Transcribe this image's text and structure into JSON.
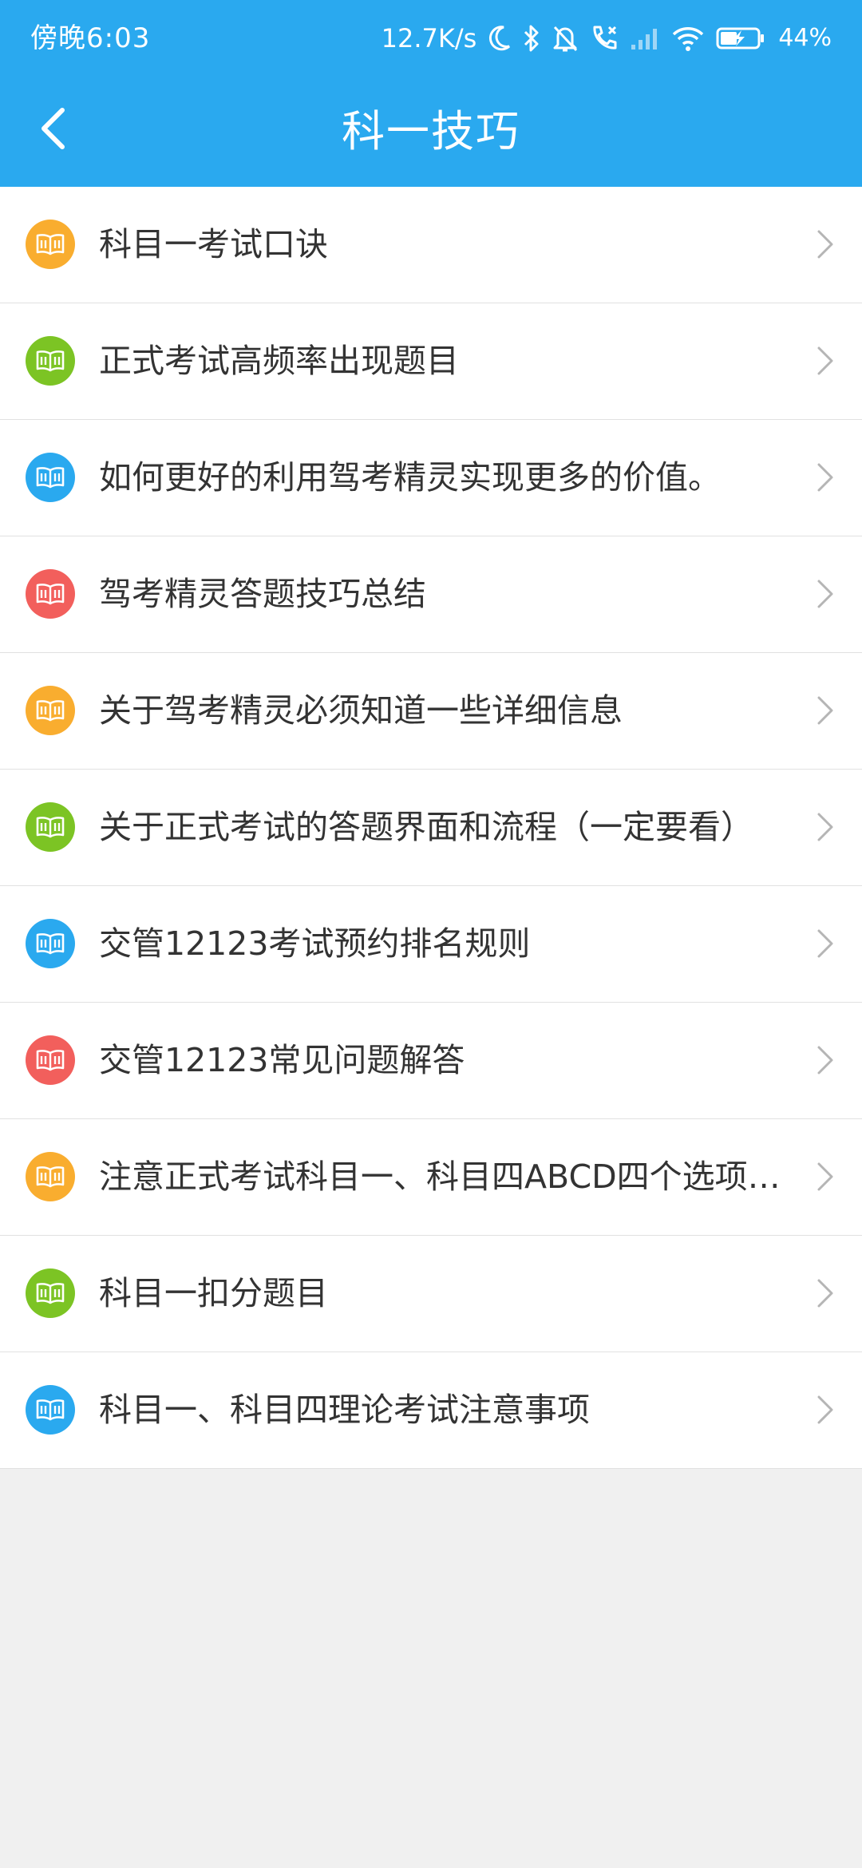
{
  "status_bar": {
    "time": "傍晚6:03",
    "network_speed": "12.7K/s",
    "battery_percent": "44%",
    "icons": [
      "moon-icon",
      "bluetooth-icon",
      "mute-bell-icon",
      "call-forward-icon",
      "cellular-signal-icon",
      "wifi-icon",
      "battery-charging-icon"
    ]
  },
  "header": {
    "title": "科一技巧",
    "back_icon": "chevron-left-icon",
    "background_color": "#2aa9ef"
  },
  "list": {
    "items": [
      {
        "label": "科目一考试口诀",
        "icon": "book-icon",
        "icon_color": "#f9ad2f"
      },
      {
        "label": "正式考试高频率出现题目",
        "icon": "book-icon",
        "icon_color": "#7cc424"
      },
      {
        "label": "如何更好的利用驾考精灵实现更多的价值。",
        "icon": "book-icon",
        "icon_color": "#2aa9ef"
      },
      {
        "label": "驾考精灵答题技巧总结",
        "icon": "book-icon",
        "icon_color": "#f25f5c"
      },
      {
        "label": "关于驾考精灵必须知道一些详细信息",
        "icon": "book-icon",
        "icon_color": "#f9ad2f"
      },
      {
        "label": "关于正式考试的答题界面和流程（一定要看）",
        "icon": "book-icon",
        "icon_color": "#7cc424"
      },
      {
        "label": "交管12123考试预约排名规则",
        "icon": "book-icon",
        "icon_color": "#2aa9ef"
      },
      {
        "label": "交管12123常见问题解答",
        "icon": "book-icon",
        "icon_color": "#f25f5c"
      },
      {
        "label": "注意正式考试科目一、科目四ABCD四个选项…",
        "icon": "book-icon",
        "icon_color": "#f9ad2f"
      },
      {
        "label": "科目一扣分题目",
        "icon": "book-icon",
        "icon_color": "#7cc424"
      },
      {
        "label": "科目一、科目四理论考试注意事项",
        "icon": "book-icon",
        "icon_color": "#2aa9ef"
      }
    ],
    "chevron_icon": "chevron-right-icon"
  }
}
